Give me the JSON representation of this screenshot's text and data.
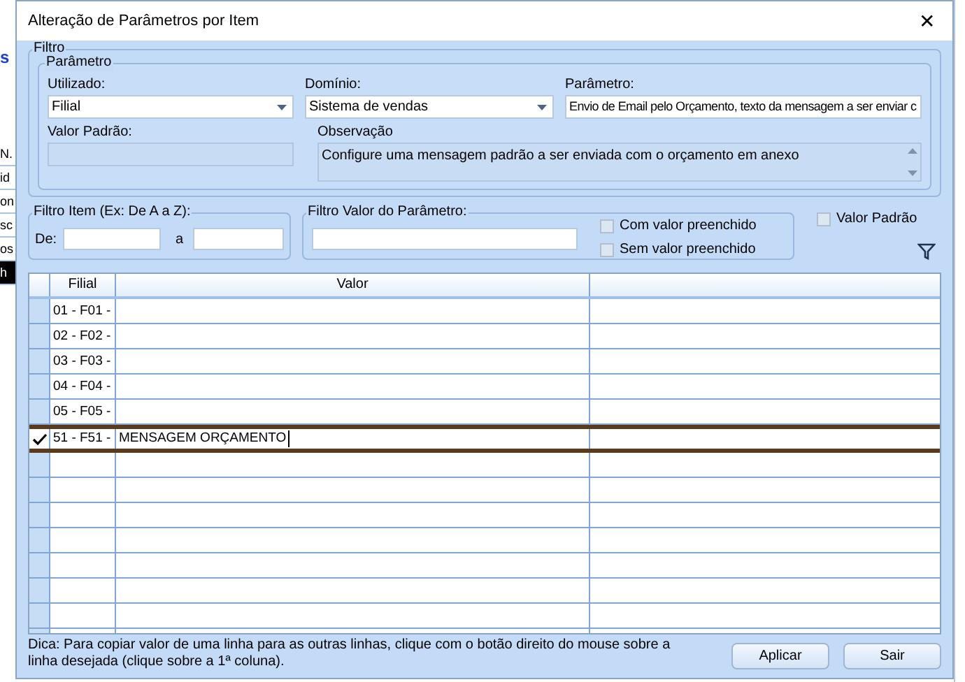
{
  "background": {
    "heading": "s",
    "rows": [
      {
        "text": "N.",
        "highlighted": false
      },
      {
        "text": "id",
        "highlighted": false
      },
      {
        "text": "on",
        "highlighted": false
      },
      {
        "text": "sc",
        "highlighted": false
      },
      {
        "text": "os",
        "highlighted": false
      },
      {
        "text": "h",
        "highlighted": true
      }
    ]
  },
  "window": {
    "title": "Alteração de Parâmetros por Item",
    "close": "✕"
  },
  "filter": {
    "legend": "Filtro",
    "parameter_group": {
      "legend": "Parâmetro",
      "used": {
        "label": "Utilizado:",
        "value": "Filial"
      },
      "domain": {
        "label": "Domínio:",
        "value": "Sistema de vendas"
      },
      "parameter": {
        "label": "Parâmetro:",
        "value": "Envio de Email pelo Orçamento,  texto da mensagem a ser enviar c"
      },
      "default_value": {
        "label": "Valor Padrão:"
      },
      "observation": {
        "label": "Observação",
        "value": "Configure uma mensagem padrão a ser enviada com o orçamento em anexo"
      }
    },
    "item_filter": {
      "legend": "Filtro Item (Ex: De A a Z):",
      "from_label": "De:",
      "to_label": "a"
    },
    "value_filter": {
      "legend": "Filtro Valor do Parâmetro:",
      "options": [
        {
          "label": "Com valor preenchido",
          "checked": false
        },
        {
          "label": "Sem valor preenchido",
          "checked": false
        }
      ]
    },
    "default_checkbox": {
      "label": "Valor Padrão",
      "checked": false
    }
  },
  "table": {
    "columns": [
      "Filial",
      "Valor"
    ],
    "rows": [
      {
        "filial": "01 - F01 -",
        "valor": "",
        "selected": false
      },
      {
        "filial": "02 - F02 -",
        "valor": "",
        "selected": false
      },
      {
        "filial": "03 - F03 -",
        "valor": "",
        "selected": false
      },
      {
        "filial": "04 - F04 -",
        "valor": "",
        "selected": false
      },
      {
        "filial": "05 - F05 -",
        "valor": "",
        "selected": false
      },
      {
        "filial": "51 - F51 -",
        "valor": "MENSAGEM ORÇAMENTO",
        "selected": true
      }
    ]
  },
  "hint": "Dica: Para copiar valor de uma linha para as outras linhas, clique com o botão direito do mouse sobre a linha desejada (clique sobre a 1ª coluna).",
  "buttons": [
    "Aplicar",
    "Sair"
  ]
}
